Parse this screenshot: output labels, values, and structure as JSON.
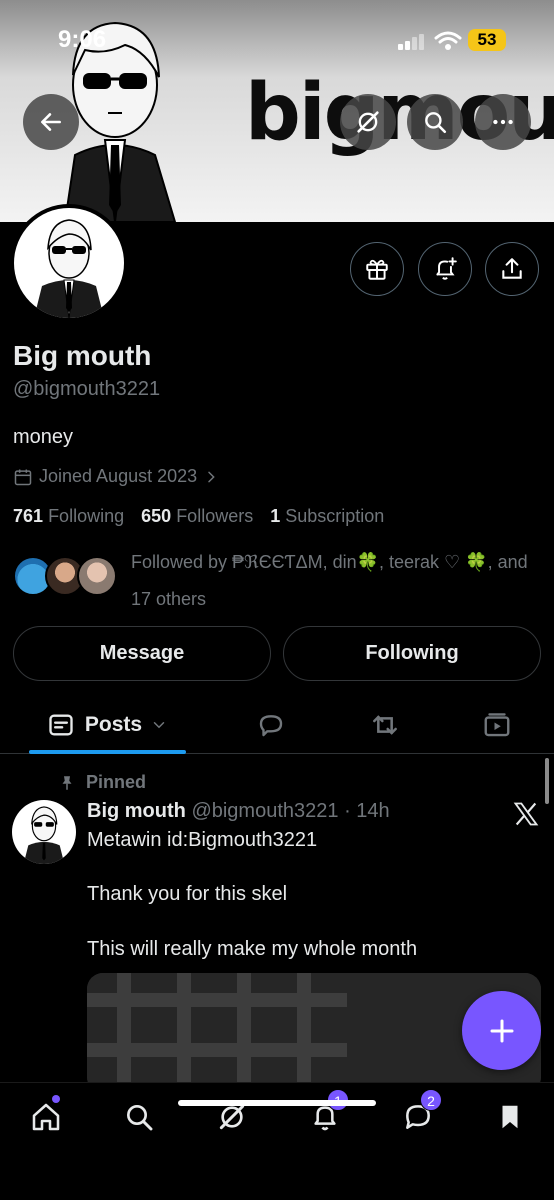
{
  "status_bar": {
    "time": "9:06",
    "battery": "53"
  },
  "banner": {
    "wordmark": "bigmouth"
  },
  "profile": {
    "name": "Big mouth",
    "handle": "@bigmouth3221",
    "bio": "money",
    "joined": "Joined August 2023",
    "following_count": "761",
    "following_label": "Following",
    "followers_count": "650",
    "followers_label": "Followers",
    "subscription_count": "1",
    "subscription_label": "Subscription",
    "followed_by": "Followed by ₱ℜЄЄƬΔM, din🍀, teerak ♡ 🍀, and 17 others"
  },
  "buttons": {
    "message": "Message",
    "following": "Following"
  },
  "tabs": {
    "posts": "Posts"
  },
  "post": {
    "pinned_label": "Pinned",
    "author": "Big mouth",
    "meta": "@bigmouth3221 · 14h",
    "lines": [
      "Metawin id:Bigmouth3221",
      "Thank you for this skel",
      "This will really make my whole month"
    ]
  },
  "bottom_nav": {
    "notifications_badge": "1",
    "messages_badge": "2"
  },
  "colors": {
    "accent": "#7856ff",
    "tab_underline": "#1d9bf0",
    "battery": "#f5c518"
  }
}
